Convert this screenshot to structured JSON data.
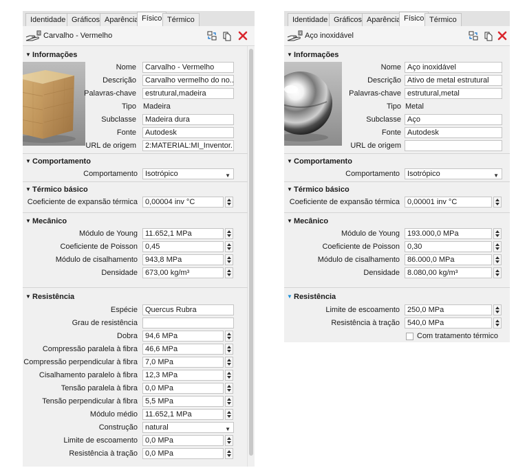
{
  "left": {
    "tabs": [
      "Identidade",
      "Gráficos",
      "Aparência",
      "Físico",
      "Térmico"
    ],
    "active_tab": "Físico",
    "material_name": "Carvalho - Vermelho",
    "sections": {
      "info": "Informações",
      "behavior": "Comportamento",
      "thermal": "Térmico básico",
      "mechanical": "Mecânico",
      "strength": "Resistência"
    },
    "info": {
      "name_label": "Nome",
      "name": "Carvalho - Vermelho",
      "desc_label": "Descrição",
      "desc": "Carvalho vermelho do no...",
      "keywords_label": "Palavras-chave",
      "keywords": "estrutural,madeira",
      "type_label": "Tipo",
      "type": "Madeira",
      "subclass_label": "Subclasse",
      "subclass": "Madeira dura",
      "source_label": "Fonte",
      "source": "Autodesk",
      "url_label": "URL de origem",
      "url": "2:MATERIAL:MI_Inventor..."
    },
    "behavior": {
      "label": "Comportamento",
      "value": "Isotrópico"
    },
    "thermal": {
      "label": "Coeficiente de expansão térmica",
      "value": "0,00004 inv °C"
    },
    "mechanical": {
      "young_label": "Módulo de Young",
      "young": "11.652,1 MPa",
      "poisson_label": "Coeficiente de Poisson",
      "poisson": "0,45",
      "shear_label": "Módulo de cisalhamento",
      "shear": "943,8 MPa",
      "density_label": "Densidade",
      "density": "673,00 kg/m³"
    },
    "strength": {
      "species_label": "Espécie",
      "species": "Quercus Rubra",
      "grade_label": "Grau de resistência",
      "grade": "",
      "bend_label": "Dobra",
      "bend": "94,6 MPa",
      "comp_par_label": "Compressão paralela à fibra",
      "comp_par": "46,6 MPa",
      "comp_perp_label": "Compressão perpendicular à fibra",
      "comp_perp": "7,0 MPa",
      "shear_par_label": "Cisalhamento paralelo à fibra",
      "shear_par": "12,3 MPa",
      "ten_par_label": "Tensão paralela à fibra",
      "ten_par": "0,0 MPa",
      "ten_perp_label": "Tensão perpendicular à fibra",
      "ten_perp": "5,5 MPa",
      "mod_avg_label": "Módulo médio",
      "mod_avg": "11.652,1 MPa",
      "constr_label": "Construção",
      "constr": "natural",
      "yield_label": "Limite de escoamento",
      "yield": "0,0 MPa",
      "tensile_label": "Resistência à tração",
      "tensile": "0,0 MPa"
    }
  },
  "right": {
    "tabs": [
      "Identidade",
      "Gráficos",
      "Aparência",
      "Físico",
      "Térmico"
    ],
    "active_tab": "Físico",
    "material_name": "Aço inoxidável",
    "sections": {
      "info": "Informações",
      "behavior": "Comportamento",
      "thermal": "Térmico básico",
      "mechanical": "Mecânico",
      "strength": "Resistência"
    },
    "info": {
      "name_label": "Nome",
      "name": "Aço inoxidável",
      "desc_label": "Descrição",
      "desc": "Ativo de metal estrutural",
      "keywords_label": "Palavras-chave",
      "keywords": "estrutural,metal",
      "type_label": "Tipo",
      "type": "Metal",
      "subclass_label": "Subclasse",
      "subclass": "Aço",
      "source_label": "Fonte",
      "source": "Autodesk",
      "url_label": "URL de origem",
      "url": ""
    },
    "behavior": {
      "label": "Comportamento",
      "value": "Isotrópico"
    },
    "thermal": {
      "label": "Coeficiente de expansão térmica",
      "value": "0,00001 inv °C"
    },
    "mechanical": {
      "young_label": "Módulo de Young",
      "young": "193.000,0 MPa",
      "poisson_label": "Coeficiente de Poisson",
      "poisson": "0,30",
      "shear_label": "Módulo de cisalhamento",
      "shear": "86.000,0 MPa",
      "density_label": "Densidade",
      "density": "8.080,00 kg/m³"
    },
    "strength": {
      "yield_label": "Limite de escoamento",
      "yield": "250,0 MPa",
      "tensile_label": "Resistência à tração",
      "tensile": "540,0 MPa",
      "heat_treat_label": "Com tratamento térmico",
      "heat_treat": false
    }
  },
  "icons": [
    "hand-material-icon",
    "swap-material-icon",
    "copy-icon",
    "delete-icon"
  ],
  "colors": {
    "delete": "#d9262d",
    "accent": "#1a8fd8"
  }
}
